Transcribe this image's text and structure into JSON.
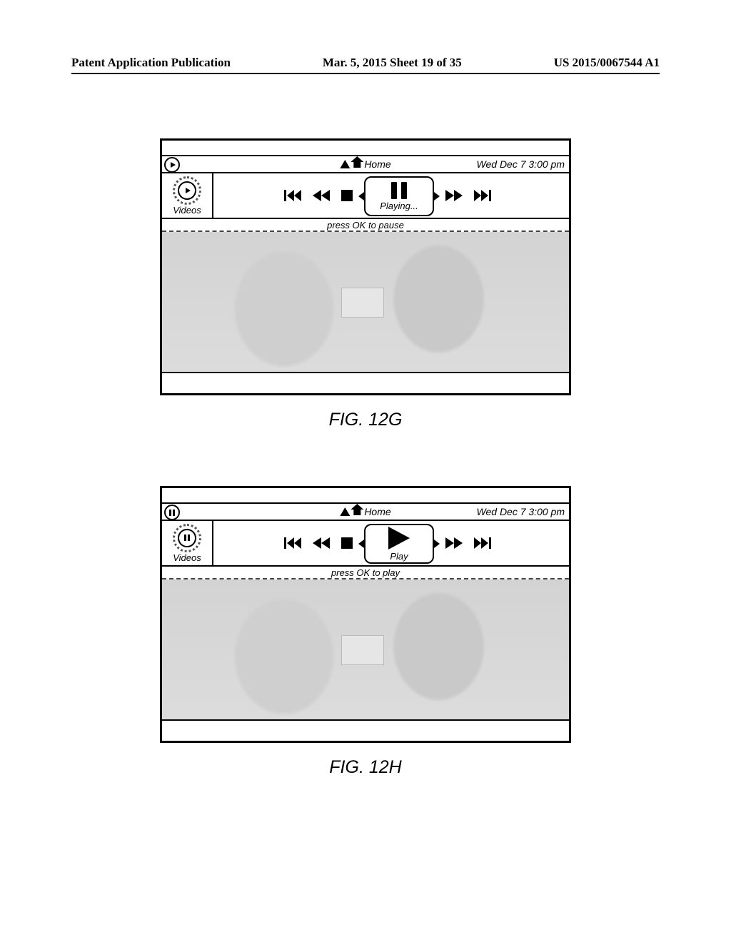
{
  "header": {
    "left": "Patent Application Publication",
    "center": "Mar. 5, 2015  Sheet 19 of 35",
    "right": "US 2015/0067544 A1"
  },
  "figures": [
    {
      "caption": "FIG. 12G",
      "status_icon": "play",
      "home_label": "Home",
      "datetime": "Wed Dec 7 3:00 pm",
      "sidebar_label": "Videos",
      "sidebar_icon": "play",
      "center_icon": "pause",
      "center_label": "Playing...",
      "hint": "press OK to pause"
    },
    {
      "caption": "FIG. 12H",
      "status_icon": "pause",
      "home_label": "Home",
      "datetime": "Wed Dec 7 3:00 pm",
      "sidebar_label": "Videos",
      "sidebar_icon": "pause",
      "center_icon": "play",
      "center_label": "Play",
      "hint": "press OK to play"
    }
  ]
}
